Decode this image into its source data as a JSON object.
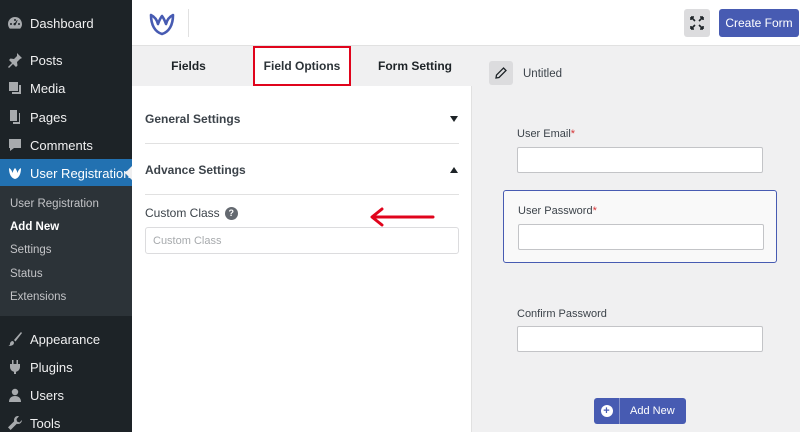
{
  "sidebar": {
    "menu_top": [
      {
        "label": "Dashboard",
        "icon": "dashboard-icon"
      },
      {
        "label": "Posts",
        "icon": "pin-icon"
      },
      {
        "label": "Media",
        "icon": "media-icon"
      },
      {
        "label": "Pages",
        "icon": "pages-icon"
      },
      {
        "label": "Comments",
        "icon": "comment-icon"
      },
      {
        "label": "User Registration",
        "icon": "user-registration-icon"
      }
    ],
    "submenu": [
      "User Registration",
      "Add New",
      "Settings",
      "Status",
      "Extensions"
    ],
    "menu_bottom": [
      {
        "label": "Appearance",
        "icon": "brush-icon"
      },
      {
        "label": "Plugins",
        "icon": "plugin-icon"
      },
      {
        "label": "Users",
        "icon": "users-icon"
      },
      {
        "label": "Tools",
        "icon": "wrench-icon"
      }
    ]
  },
  "topbar": {
    "create_form_label": "Create Form",
    "fullscreen_icon": "fullscreen-icon"
  },
  "settings": {
    "tabs": [
      "Fields",
      "Field Options",
      "Form Setting"
    ],
    "active_tab": "Field Options",
    "sections": {
      "general": "General Settings",
      "advance": "Advance Settings"
    },
    "custom_class": {
      "label": "Custom Class",
      "placeholder": "Custom Class",
      "value": ""
    }
  },
  "preview": {
    "form_title": "Untitled",
    "fields": [
      {
        "label": "User Email",
        "required": "*"
      },
      {
        "label": "User Password",
        "required": "*"
      },
      {
        "label": "Confirm Password",
        "required": ""
      }
    ],
    "add_new_label": "Add New"
  },
  "colors": {
    "accent": "#475bb2",
    "wp_blue": "#2271b1",
    "annotation_red": "#e0041c"
  }
}
